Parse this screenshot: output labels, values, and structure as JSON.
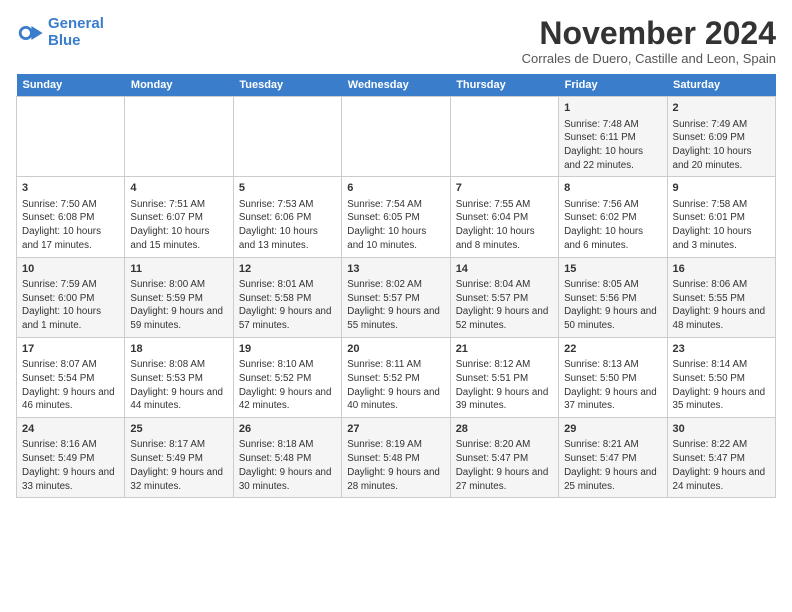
{
  "logo": {
    "line1": "General",
    "line2": "Blue"
  },
  "header": {
    "month": "November 2024",
    "location": "Corrales de Duero, Castille and Leon, Spain"
  },
  "weekdays": [
    "Sunday",
    "Monday",
    "Tuesday",
    "Wednesday",
    "Thursday",
    "Friday",
    "Saturday"
  ],
  "weeks": [
    [
      {
        "day": "",
        "detail": ""
      },
      {
        "day": "",
        "detail": ""
      },
      {
        "day": "",
        "detail": ""
      },
      {
        "day": "",
        "detail": ""
      },
      {
        "day": "",
        "detail": ""
      },
      {
        "day": "1",
        "detail": "Sunrise: 7:48 AM\nSunset: 6:11 PM\nDaylight: 10 hours and 22 minutes."
      },
      {
        "day": "2",
        "detail": "Sunrise: 7:49 AM\nSunset: 6:09 PM\nDaylight: 10 hours and 20 minutes."
      }
    ],
    [
      {
        "day": "3",
        "detail": "Sunrise: 7:50 AM\nSunset: 6:08 PM\nDaylight: 10 hours and 17 minutes."
      },
      {
        "day": "4",
        "detail": "Sunrise: 7:51 AM\nSunset: 6:07 PM\nDaylight: 10 hours and 15 minutes."
      },
      {
        "day": "5",
        "detail": "Sunrise: 7:53 AM\nSunset: 6:06 PM\nDaylight: 10 hours and 13 minutes."
      },
      {
        "day": "6",
        "detail": "Sunrise: 7:54 AM\nSunset: 6:05 PM\nDaylight: 10 hours and 10 minutes."
      },
      {
        "day": "7",
        "detail": "Sunrise: 7:55 AM\nSunset: 6:04 PM\nDaylight: 10 hours and 8 minutes."
      },
      {
        "day": "8",
        "detail": "Sunrise: 7:56 AM\nSunset: 6:02 PM\nDaylight: 10 hours and 6 minutes."
      },
      {
        "day": "9",
        "detail": "Sunrise: 7:58 AM\nSunset: 6:01 PM\nDaylight: 10 hours and 3 minutes."
      }
    ],
    [
      {
        "day": "10",
        "detail": "Sunrise: 7:59 AM\nSunset: 6:00 PM\nDaylight: 10 hours and 1 minute."
      },
      {
        "day": "11",
        "detail": "Sunrise: 8:00 AM\nSunset: 5:59 PM\nDaylight: 9 hours and 59 minutes."
      },
      {
        "day": "12",
        "detail": "Sunrise: 8:01 AM\nSunset: 5:58 PM\nDaylight: 9 hours and 57 minutes."
      },
      {
        "day": "13",
        "detail": "Sunrise: 8:02 AM\nSunset: 5:57 PM\nDaylight: 9 hours and 55 minutes."
      },
      {
        "day": "14",
        "detail": "Sunrise: 8:04 AM\nSunset: 5:57 PM\nDaylight: 9 hours and 52 minutes."
      },
      {
        "day": "15",
        "detail": "Sunrise: 8:05 AM\nSunset: 5:56 PM\nDaylight: 9 hours and 50 minutes."
      },
      {
        "day": "16",
        "detail": "Sunrise: 8:06 AM\nSunset: 5:55 PM\nDaylight: 9 hours and 48 minutes."
      }
    ],
    [
      {
        "day": "17",
        "detail": "Sunrise: 8:07 AM\nSunset: 5:54 PM\nDaylight: 9 hours and 46 minutes."
      },
      {
        "day": "18",
        "detail": "Sunrise: 8:08 AM\nSunset: 5:53 PM\nDaylight: 9 hours and 44 minutes."
      },
      {
        "day": "19",
        "detail": "Sunrise: 8:10 AM\nSunset: 5:52 PM\nDaylight: 9 hours and 42 minutes."
      },
      {
        "day": "20",
        "detail": "Sunrise: 8:11 AM\nSunset: 5:52 PM\nDaylight: 9 hours and 40 minutes."
      },
      {
        "day": "21",
        "detail": "Sunrise: 8:12 AM\nSunset: 5:51 PM\nDaylight: 9 hours and 39 minutes."
      },
      {
        "day": "22",
        "detail": "Sunrise: 8:13 AM\nSunset: 5:50 PM\nDaylight: 9 hours and 37 minutes."
      },
      {
        "day": "23",
        "detail": "Sunrise: 8:14 AM\nSunset: 5:50 PM\nDaylight: 9 hours and 35 minutes."
      }
    ],
    [
      {
        "day": "24",
        "detail": "Sunrise: 8:16 AM\nSunset: 5:49 PM\nDaylight: 9 hours and 33 minutes."
      },
      {
        "day": "25",
        "detail": "Sunrise: 8:17 AM\nSunset: 5:49 PM\nDaylight: 9 hours and 32 minutes."
      },
      {
        "day": "26",
        "detail": "Sunrise: 8:18 AM\nSunset: 5:48 PM\nDaylight: 9 hours and 30 minutes."
      },
      {
        "day": "27",
        "detail": "Sunrise: 8:19 AM\nSunset: 5:48 PM\nDaylight: 9 hours and 28 minutes."
      },
      {
        "day": "28",
        "detail": "Sunrise: 8:20 AM\nSunset: 5:47 PM\nDaylight: 9 hours and 27 minutes."
      },
      {
        "day": "29",
        "detail": "Sunrise: 8:21 AM\nSunset: 5:47 PM\nDaylight: 9 hours and 25 minutes."
      },
      {
        "day": "30",
        "detail": "Sunrise: 8:22 AM\nSunset: 5:47 PM\nDaylight: 9 hours and 24 minutes."
      }
    ]
  ]
}
